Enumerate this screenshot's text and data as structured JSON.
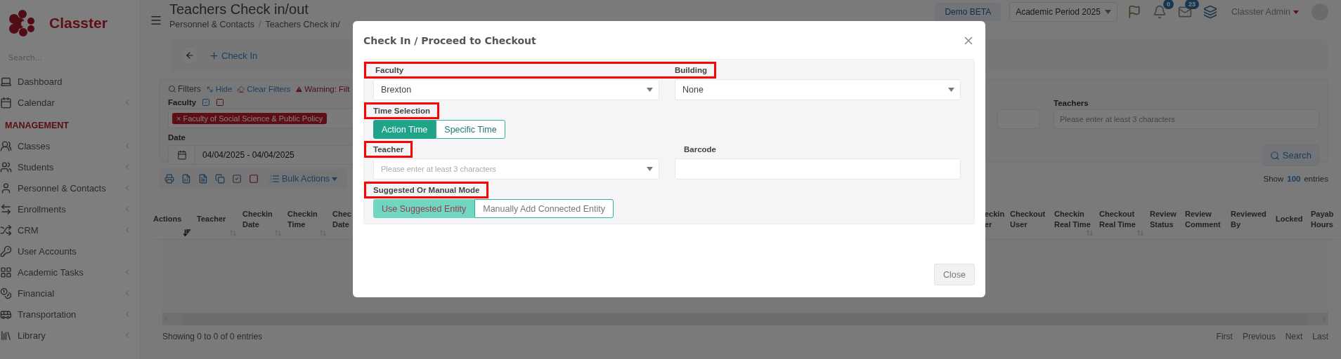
{
  "sidebar": {
    "brand": "Classter",
    "search_placeholder": "Search...",
    "items": [
      {
        "kind": "link",
        "label": "Dashboard",
        "submenu": false
      },
      {
        "kind": "link",
        "label": "Calendar",
        "submenu": true
      },
      {
        "kind": "section",
        "label": "MANAGEMENT"
      },
      {
        "kind": "link",
        "label": "Classes",
        "submenu": true
      },
      {
        "kind": "link",
        "label": "Students",
        "submenu": true
      },
      {
        "kind": "link",
        "label": "Personnel & Contacts",
        "submenu": true
      },
      {
        "kind": "link",
        "label": "Enrollments",
        "submenu": true
      },
      {
        "kind": "link",
        "label": "CRM",
        "submenu": true
      },
      {
        "kind": "link",
        "label": "User Accounts",
        "submenu": false
      },
      {
        "kind": "link",
        "label": "Academic Tasks",
        "submenu": true
      },
      {
        "kind": "link",
        "label": "Financial",
        "submenu": true
      },
      {
        "kind": "link",
        "label": "Transportation",
        "submenu": true
      },
      {
        "kind": "link",
        "label": "Library",
        "submenu": true
      }
    ]
  },
  "header": {
    "title": "Teachers Check in/out",
    "breadcrumb": [
      "Personnel & Contacts",
      "Teachers Check in/"
    ],
    "breadcrumb_separator": "/"
  },
  "top_bar": {
    "environment": "Demo BETA",
    "period": "Academic Period 2025",
    "notifications": "0",
    "messages": "23",
    "user": "Classter Admin"
  },
  "action_bar": {
    "check_in": "Check In"
  },
  "filters": {
    "title": "Filters",
    "hide": "Hide",
    "clear": "Clear Filters",
    "warning": "Warning: Filt",
    "faculty": {
      "label": "Faculty",
      "tag_remove": "×",
      "tags": [
        "Faculty of Social Science & Public Policy"
      ]
    },
    "date": {
      "label": "Date",
      "value": "04/04/2025 - 04/04/2025"
    },
    "teachers": {
      "label": "Teachers",
      "placeholder": "Please enter at least 3 characters"
    },
    "search": "Search"
  },
  "list_tools": {
    "bulk_actions": "Bulk Actions",
    "show": "Show",
    "page_size": "100",
    "entries": "entries"
  },
  "table": {
    "columns_left": [
      {
        "label": "Actions",
        "sortable": true,
        "sorted": true
      },
      {
        "label": "Teacher",
        "sortable": true,
        "sorted": false
      },
      {
        "label": "Checkin Date",
        "sortable": true,
        "sorted": false
      },
      {
        "label": "Checkin Time",
        "sortable": true,
        "sorted": false
      },
      {
        "label": "Chec Date",
        "sortable": false,
        "sorted": false
      }
    ],
    "columns_right": [
      {
        "label": "eckin er",
        "sortable": false,
        "sorted": false
      },
      {
        "label": "Checkout User",
        "sortable": false,
        "sorted": false
      },
      {
        "label": "Checkin Real Time",
        "sortable": true,
        "sorted": false
      },
      {
        "label": "Checkout Real Time",
        "sortable": true,
        "sorted": false
      },
      {
        "label": "Review Status",
        "sortable": false,
        "sorted": false
      },
      {
        "label": "Review Comment",
        "sortable": false,
        "sorted": false
      },
      {
        "label": "Reviewed By",
        "sortable": false,
        "sorted": false
      },
      {
        "label": "Locked",
        "sortable": false,
        "sorted": false
      },
      {
        "label": "Payab Hours",
        "sortable": false,
        "sorted": false
      }
    ]
  },
  "footer": {
    "summary": "Showing 0 to 0 of 0 entries",
    "pages": [
      "First",
      "Previous",
      "Next",
      "Last"
    ]
  },
  "modal": {
    "title": "Check In / Proceed to Checkout",
    "rows": [
      {
        "labels": [
          {
            "text": "Faculty",
            "highlighted": true
          },
          {
            "text": "Building",
            "highlighted": true
          }
        ],
        "fields": [
          {
            "kind": "select",
            "value": "Brexton"
          },
          {
            "kind": "select",
            "value": "None"
          }
        ]
      },
      {
        "labels": [
          {
            "text": "Time Selection",
            "highlighted": true
          }
        ],
        "fields": [
          {
            "kind": "toggle",
            "disabled": false,
            "options": [
              {
                "label": "Action Time",
                "selected": true
              },
              {
                "label": "Specific Time",
                "selected": false
              }
            ]
          }
        ]
      },
      {
        "labels": [
          {
            "text": "Teacher",
            "highlighted": true
          },
          {
            "text": "Barcode",
            "highlighted": false
          }
        ],
        "fields": [
          {
            "kind": "select",
            "placeholder": "Please enter at least 3 characters"
          },
          {
            "kind": "text"
          }
        ]
      },
      {
        "labels": [
          {
            "text": "Suggested Or Manual Mode",
            "highlighted": true
          }
        ],
        "fields": [
          {
            "kind": "toggle",
            "disabled": true,
            "options": [
              {
                "label": "Use Suggested Entity",
                "selected": true
              },
              {
                "label": "Manually Add Connected Entity",
                "selected": false
              }
            ]
          }
        ]
      }
    ],
    "close": "Close"
  }
}
